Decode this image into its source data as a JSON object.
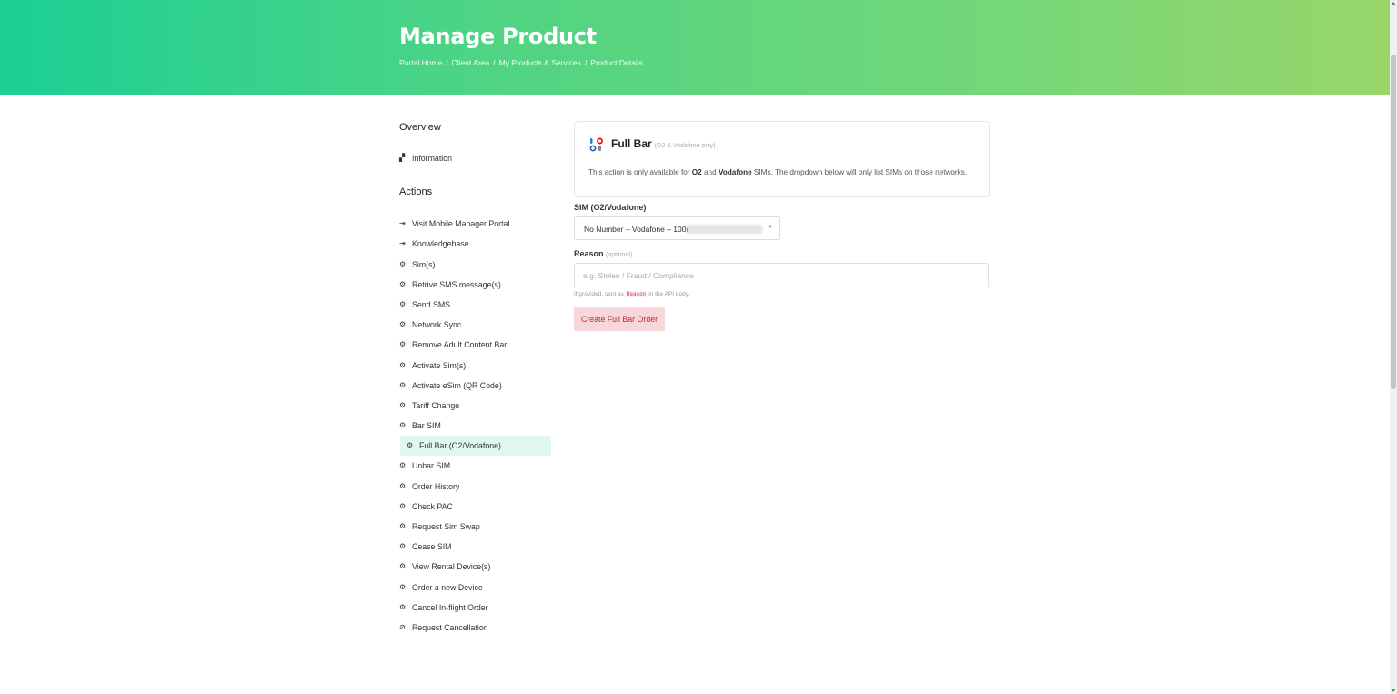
{
  "header": {
    "title": "Manage Product",
    "breadcrumb": [
      "Portal Home",
      "Client Area",
      "My Products & Services",
      "Product Details"
    ]
  },
  "sidebar": {
    "overview_heading": "Overview",
    "overview_items": [
      {
        "label": "Information",
        "icon": "dashboard-icon"
      }
    ],
    "actions_heading": "Actions",
    "action_items": [
      {
        "label": "Visit Mobile Manager Portal",
        "icon": "sign-in-icon"
      },
      {
        "label": "Knowledgebase",
        "icon": "sign-in-icon"
      },
      {
        "label": "Sim(s)",
        "icon": "cogs-icon"
      },
      {
        "label": "Retrive SMS message(s)",
        "icon": "cogs-icon"
      },
      {
        "label": "Send SMS",
        "icon": "cogs-icon"
      },
      {
        "label": "Network Sync",
        "icon": "cogs-icon"
      },
      {
        "label": "Remove Adult Content Bar",
        "icon": "cogs-icon"
      },
      {
        "label": "Activate Sim(s)",
        "icon": "cogs-icon"
      },
      {
        "label": "Activate eSim (QR Code)",
        "icon": "cogs-icon"
      },
      {
        "label": "Tariff Change",
        "icon": "cogs-icon"
      },
      {
        "label": "Bar SIM",
        "icon": "cogs-icon"
      },
      {
        "label": "Full Bar (O2/Vodafone)",
        "icon": "cogs-icon",
        "active": true
      },
      {
        "label": "Unbar SIM",
        "icon": "cogs-icon"
      },
      {
        "label": "Order History",
        "icon": "cogs-icon"
      },
      {
        "label": "Check PAC",
        "icon": "cogs-icon"
      },
      {
        "label": "Request Sim Swap",
        "icon": "cogs-icon"
      },
      {
        "label": "Cease SIM",
        "icon": "cogs-icon"
      },
      {
        "label": "View Rental Device(s)",
        "icon": "cogs-icon"
      },
      {
        "label": "Order a new Device",
        "icon": "cogs-icon"
      },
      {
        "label": "Cancel In-flight Order",
        "icon": "cogs-icon"
      },
      {
        "label": "Request Cancellation",
        "icon": "ban-icon"
      }
    ]
  },
  "card": {
    "title": "Full Bar",
    "title_note": "(O2 & Vodafone only)",
    "desc_prefix": "This action is only available for ",
    "desc_o2": "O2",
    "desc_and": " and ",
    "desc_vodafone": "Vodafone",
    "desc_suffix": " SIMs. The dropdown below will only list SIMs on those networks."
  },
  "form": {
    "sim_label": "SIM (O2/Vodafone)",
    "sim_value": "No Number – Vodafone – 100(",
    "reason_label": "Reason",
    "reason_optional": "(optional)",
    "reason_placeholder": "e.g. Stolen / Fraud / Compliance",
    "help_prefix": "If provided, sent as ",
    "help_code": "Reason",
    "help_suffix": " in the API body.",
    "submit_label": "Create Full Bar Order"
  },
  "colors": {
    "header_start": "#1ccf95",
    "header_end": "#99d66a",
    "active_bg": "#dff8f0",
    "button_bg": "#f8d7da",
    "button_text": "#c02a3a"
  }
}
